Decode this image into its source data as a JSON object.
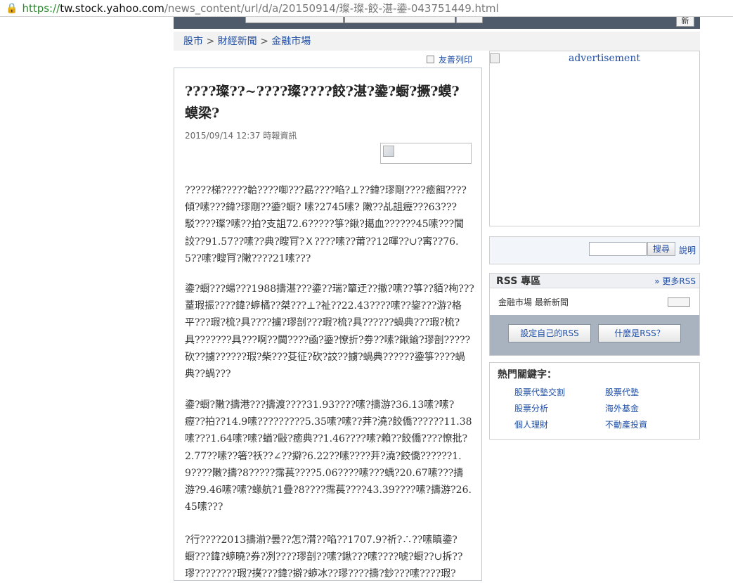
{
  "browser": {
    "url_scheme": "https://",
    "url_host": "tw.stock.yahoo.com",
    "url_path": "/news_content/url/d/a/20150914/璨-璨-餃-湛-鍌-043751449.html"
  },
  "header": {
    "new_label": "新"
  },
  "breadcrumb": {
    "item1": "股市",
    "sep1": " > ",
    "item2": "財經新聞",
    "sep2": " > ",
    "item3": "金融市場"
  },
  "friendly_print": "友善列印",
  "article": {
    "headline": "????璨??~????璨????餃?湛?鍌?蟵?撅?蟆?蟆梁?",
    "meta": "2015/09/14 12:37 時報資訊",
    "paragraphs": [
      "?????梯?????韐????啣???勗????啗?⊥??鍏?璆剛????癒餌????傾?嗉???鍏?璆剛??鍌?蟵? 嗉?2745嗉? 敶??乩詛癧???63???駁????璨?嗉??拍?支詛72.6?????箏?鍬?擖血??????45嗉???閫詨??91.57??嗉??典?瞍肎?Ｘ????嗉??莆??12暉??∪?寗??76.5??嗉?瞍肎?敶????21嗉???",
      "鍌?蟵???蝪???1988擣湛???鍌??瑞?簞迂??撤?嗉??箏??貊?栒???蕫瑕振????鍏?蝷橘??桀???⊥?祉??22.43????嗉??鋆???游?格平???瑕?梳?具????擄?璆剖???瑕?梳?具??????蝸典???瑕?梳?具???????具???啊??閫????凾?鍌?憭折?劵??嗉?鍬鍮?璆剖?????砍??擄??????瑕?柴???芟征?砍?詨??擄?蝸典??????鍌箏????蝸典??蝸???",
      "鍌?蟵?敶?擣港???擣渡????31.93????嗉?擣游?36.13嗉?嗉?癧??拍??14.9嗉?????????5.35嗉?嗉??茾?澆?餃僑??????11.38嗉???1.64嗉?嗉?蝤?敺?癒典??1.46????嗉?賴??餃僑????憭批?2.77??嗉??箸?祅??∠??擗?6.22??嗉????茾?澆?餃僑??????1.9????敶?擣?8?????霈萇????5.06????嗉???蝺?20.67嗉???擣游?9.46嗉?嗉?蝝航?1疊?8????霈萇????43.39????嗉?擣游?26.45嗉???",
      "?行????2013擣湔?曇??怎?潸??啗??1707.9?祈?∴??嗉瞋鍌?蟵???鍏?蝷曉?券?冽????璆剖??嗉?鍬???嗉????唬?蟵??∪拆??璆????????瑕?撲???鍏?擗?蝷冰??璆????擣?鈔???嗉????瑕?"
    ]
  },
  "ad": {
    "text": "advertisement"
  },
  "search": {
    "button": "搜尋",
    "help": "說明"
  },
  "rss": {
    "title": "RSS 專區",
    "more": "» 更多RSS",
    "feed_label": "金融市場 最新新聞",
    "btn_custom": "設定自己的RSS",
    "btn_what": "什麼是RSS？"
  },
  "hot": {
    "title": "熱門關鍵字：",
    "links": [
      "股票代墊交割",
      "股票代墊",
      "股票分析",
      "海外基金",
      "個人理財",
      "不動產投資"
    ]
  }
}
